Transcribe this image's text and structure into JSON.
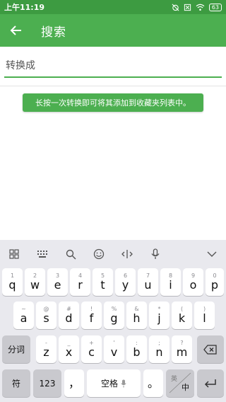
{
  "status_bar": {
    "time": "上午11:19",
    "battery": "63"
  },
  "app_bar": {
    "title": "搜索"
  },
  "search": {
    "placeholder": "转换成",
    "value": ""
  },
  "toast": "长按一次转换即可将其添加到收藏夹列表中。",
  "keyboard": {
    "toolbar": [
      "grid-icon",
      "keypad-icon",
      "search-icon",
      "emoji-icon",
      "cursor-icon",
      "microphone-icon",
      "chevron-down-icon"
    ],
    "row1": [
      {
        "main": "q",
        "hint": "1"
      },
      {
        "main": "w",
        "hint": "2"
      },
      {
        "main": "e",
        "hint": "3"
      },
      {
        "main": "r",
        "hint": "4"
      },
      {
        "main": "t",
        "hint": "5"
      },
      {
        "main": "y",
        "hint": "6"
      },
      {
        "main": "u",
        "hint": "7"
      },
      {
        "main": "i",
        "hint": "8"
      },
      {
        "main": "o",
        "hint": "9"
      },
      {
        "main": "p",
        "hint": "0"
      }
    ],
    "row2": [
      {
        "main": "a",
        "hint": "~"
      },
      {
        "main": "s",
        "hint": "@"
      },
      {
        "main": "d",
        "hint": "#"
      },
      {
        "main": "f",
        "hint": "!"
      },
      {
        "main": "g",
        "hint": "%"
      },
      {
        "main": "h",
        "hint": "&"
      },
      {
        "main": "j",
        "hint": "*"
      },
      {
        "main": "k",
        "hint": "("
      },
      {
        "main": "l",
        "hint": ")"
      }
    ],
    "row3": [
      {
        "main": "z",
        "hint": "-"
      },
      {
        "main": "x",
        "hint": "_"
      },
      {
        "main": "c",
        "hint": "+"
      },
      {
        "main": "v",
        "hint": "'"
      },
      {
        "main": "b",
        "hint": ":"
      },
      {
        "main": "n",
        "hint": ";"
      },
      {
        "main": "m",
        "hint": "?"
      }
    ],
    "fenci": "分词",
    "fu": "符",
    "num": "123",
    "comma": "，",
    "space": "空格",
    "period": "。",
    "lang": {
      "top": "英",
      "bottom": "中"
    }
  }
}
